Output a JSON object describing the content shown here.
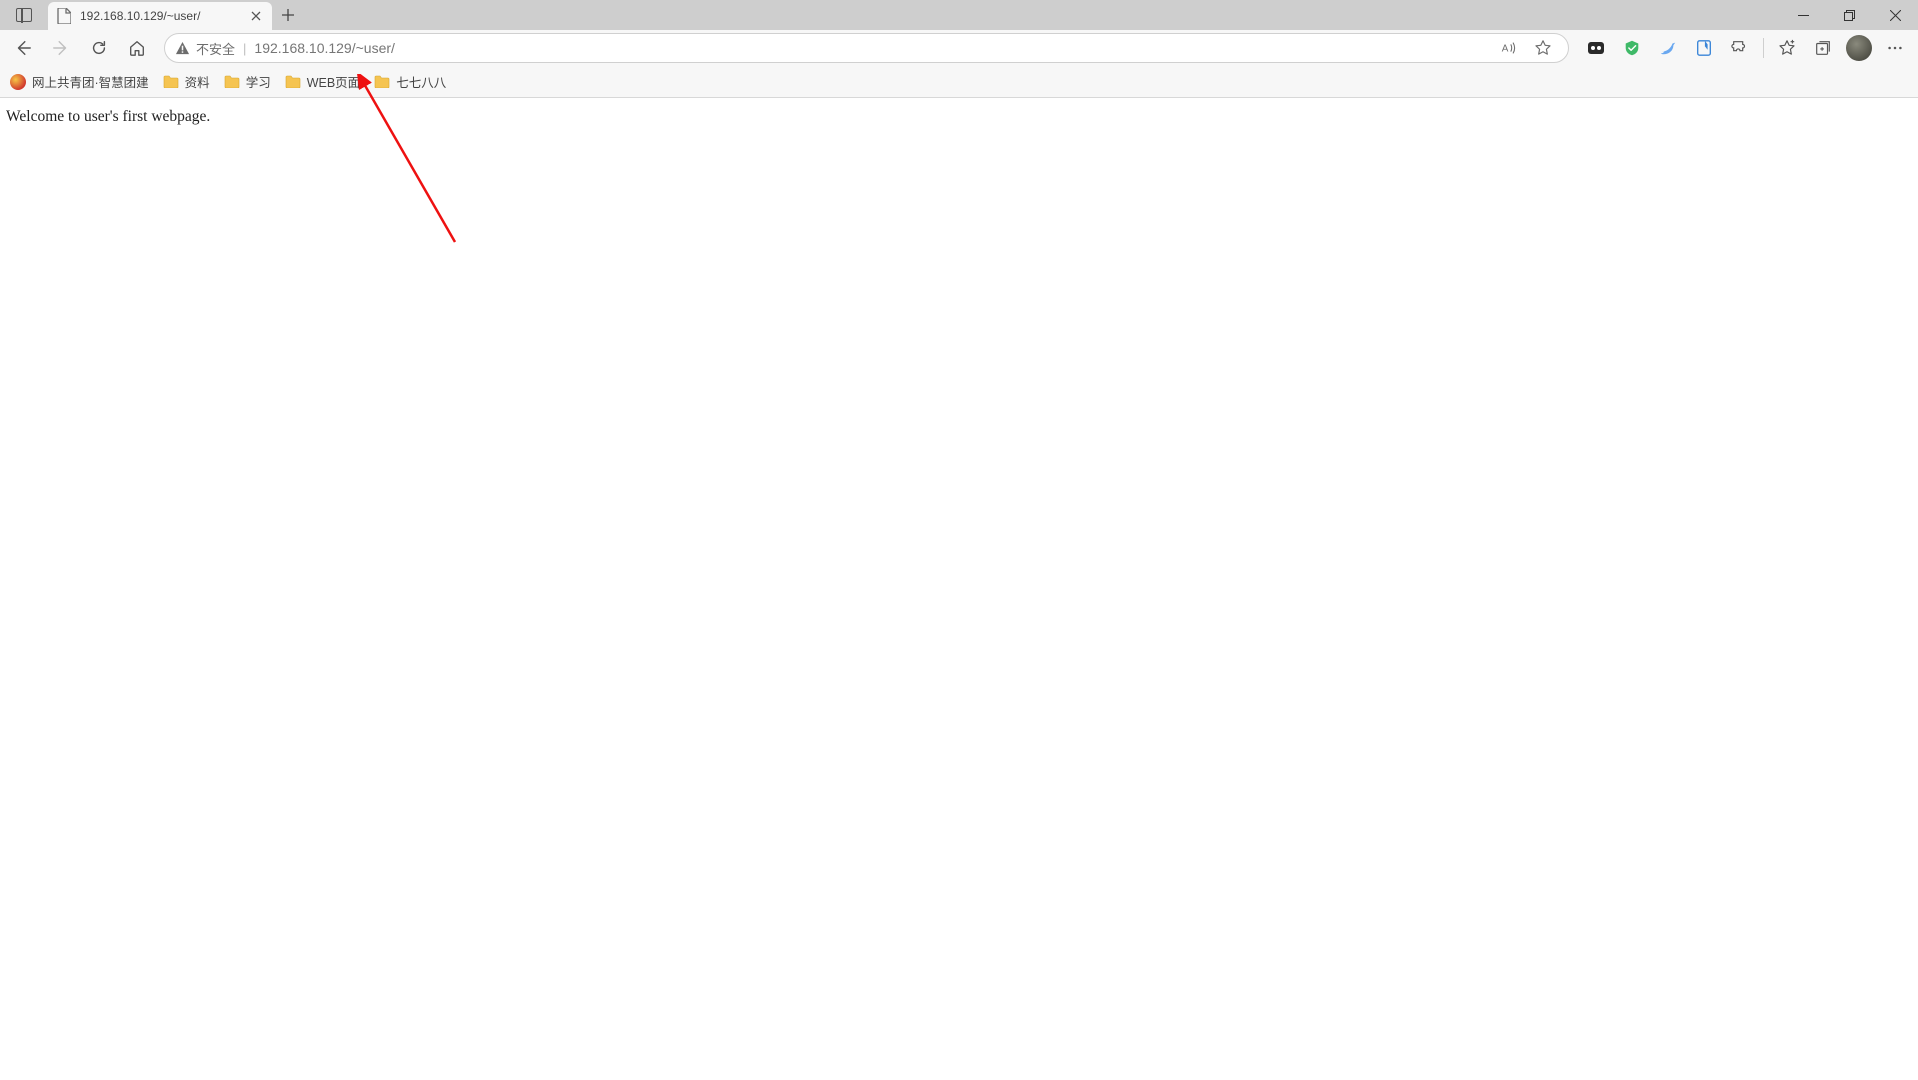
{
  "tab": {
    "title": "192.168.10.129/~user/"
  },
  "address": {
    "security_label": "不安全",
    "url": "192.168.10.129/~user/"
  },
  "bookmarks": [
    {
      "label": "网上共青团·智慧团建",
      "icon": "circle"
    },
    {
      "label": "资料",
      "icon": "folder"
    },
    {
      "label": "学习",
      "icon": "folder"
    },
    {
      "label": "WEB页面",
      "icon": "folder"
    },
    {
      "label": "七七八八",
      "icon": "folder"
    }
  ],
  "page": {
    "body_text": "Welcome to user's first webpage."
  }
}
